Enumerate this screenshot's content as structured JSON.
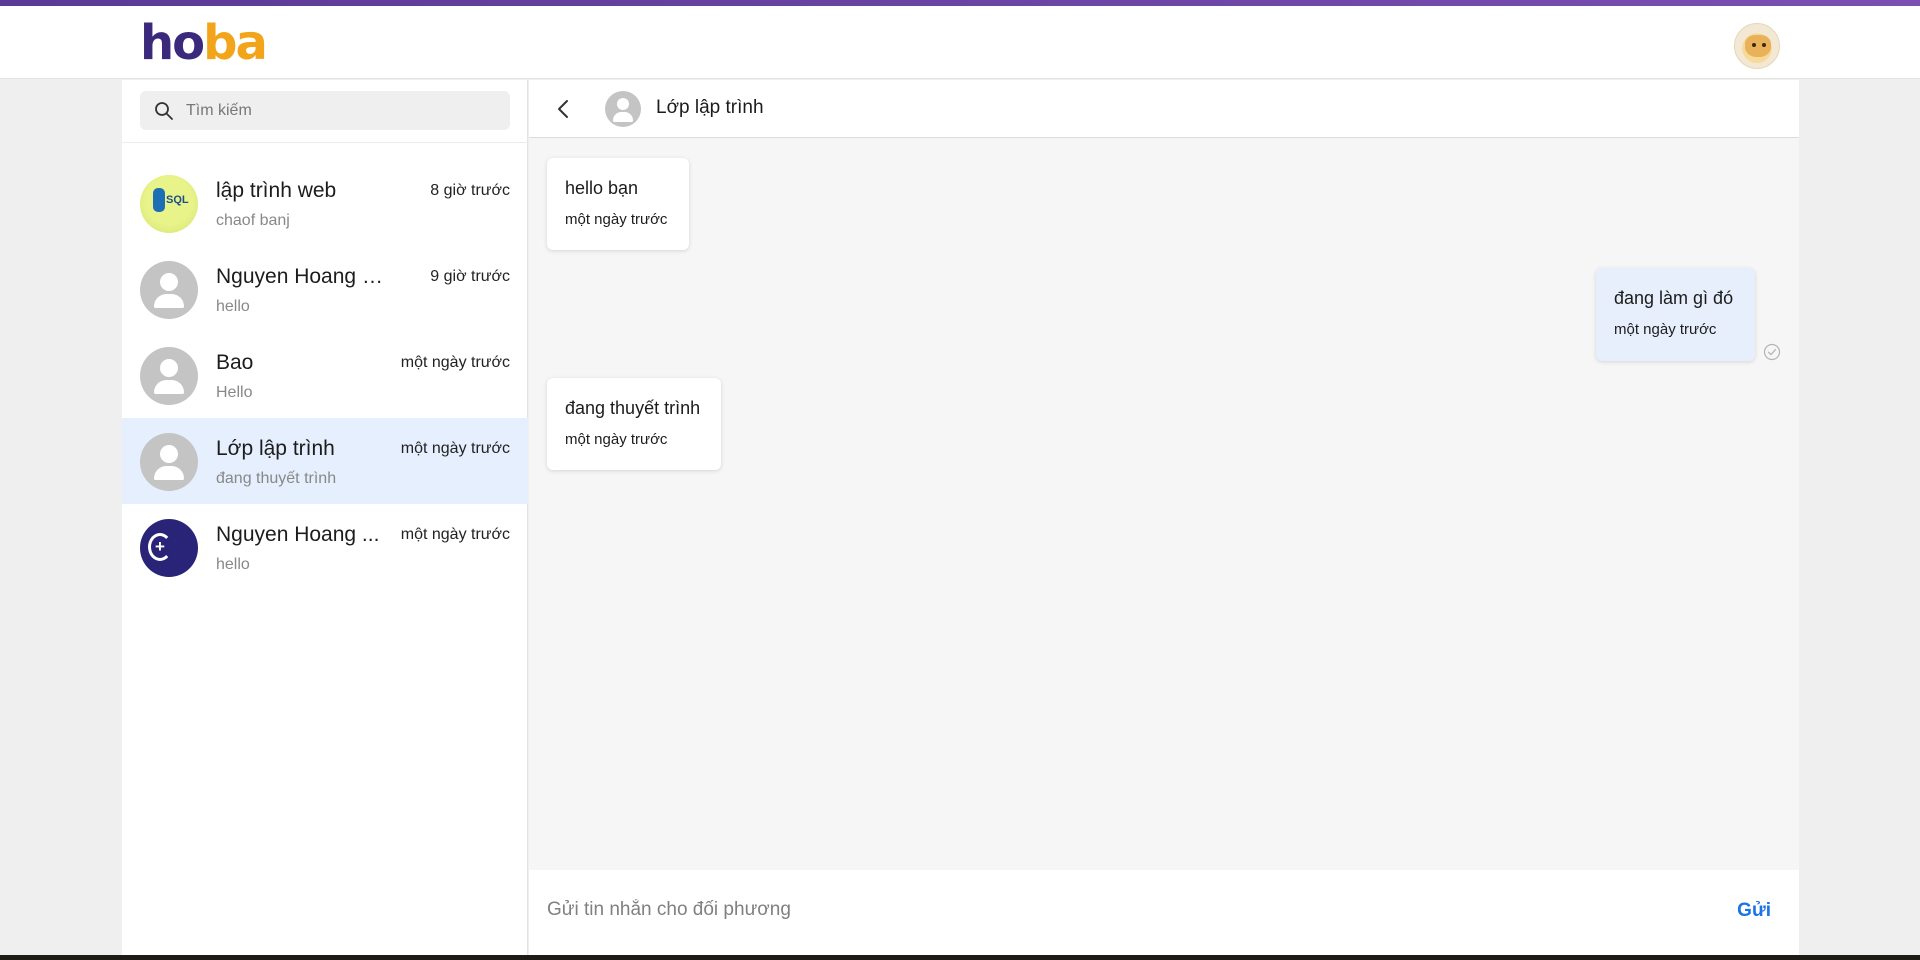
{
  "header": {
    "logo": [
      "h",
      "o",
      "b",
      "a"
    ],
    "user_avatar_icon": "user-avatar-icon"
  },
  "search": {
    "placeholder": "Tìm kiếm",
    "icon": "search-icon"
  },
  "conversations": [
    {
      "name": "lập trình web",
      "time": "8 giờ trước",
      "preview": "chaof banj",
      "avatar": "sql-logo",
      "active": false
    },
    {
      "name": "Nguyen Hoang Bao",
      "time": "9 giờ trước",
      "preview": "hello",
      "avatar": "default-user-icon",
      "active": false
    },
    {
      "name": "Bao",
      "time": "một ngày trước",
      "preview": "Hello",
      "avatar": "default-user-icon",
      "active": false
    },
    {
      "name": "Lớp lập trình",
      "time": "một ngày trước",
      "preview": "đang thuyết trình",
      "avatar": "default-user-icon",
      "active": true
    },
    {
      "name": "Nguyen Hoang ...",
      "time": "một ngày trước",
      "preview": "hello",
      "avatar": "cpp-logo",
      "active": false
    }
  ],
  "chat": {
    "title": "Lớp lập trình",
    "back_icon": "chevron-left-icon",
    "messages": [
      {
        "text": "hello bạn",
        "time": "một ngày trước",
        "direction": "incoming"
      },
      {
        "text": "đang làm gì đó",
        "time": "một ngày trước",
        "direction": "outgoing",
        "seen": true
      },
      {
        "text": "đang thuyết trình",
        "time": "một ngày trước",
        "direction": "incoming"
      }
    ]
  },
  "composer": {
    "placeholder": "Gửi tin nhắn cho đối phương",
    "send_label": "Gửi"
  },
  "colors": {
    "accent": "#1a73e8",
    "active_row": "#e6effd",
    "logo_primary": "#3b2a7c",
    "logo_secondary": "#f2a51a",
    "top_bar": "#5a3a94"
  }
}
